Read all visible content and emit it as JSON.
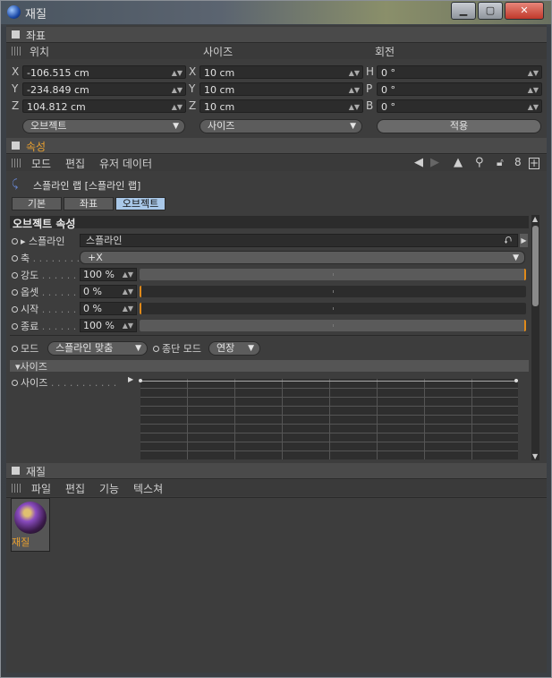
{
  "window": {
    "title": "재질"
  },
  "coords": {
    "panel_title": "좌표",
    "col_position": "위치",
    "col_size": "사이즈",
    "col_rotation": "회전",
    "position": [
      {
        "axis": "X",
        "value": "-106.515 cm"
      },
      {
        "axis": "Y",
        "value": "-234.849 cm"
      },
      {
        "axis": "Z",
        "value": "104.812 cm"
      }
    ],
    "size": [
      {
        "axis": "X",
        "value": "10 cm"
      },
      {
        "axis": "Y",
        "value": "10 cm"
      },
      {
        "axis": "Z",
        "value": "10 cm"
      }
    ],
    "rotation": [
      {
        "axis": "H",
        "value": "0 °"
      },
      {
        "axis": "P",
        "value": "0 °"
      },
      {
        "axis": "B",
        "value": "0 °"
      }
    ],
    "mode_select": "오브젝트",
    "size_select": "사이즈",
    "apply_label": "적용"
  },
  "attributes": {
    "panel_title": "속성",
    "menu": [
      "모드",
      "편집",
      "유저 데이터"
    ],
    "object_title": "스플라인 랩 [스플라인 랩]",
    "tabs": [
      "기본",
      "좌표",
      "오브젝트"
    ],
    "active_tab": 2,
    "section_title": "오브젝트 속성",
    "spline_label": "스플라인",
    "spline_value": "스플라인",
    "axis_label": "축",
    "axis_value": "+X",
    "strength_label": "강도",
    "strength_value": "100 %",
    "strength_fill": 1.0,
    "offset_label": "옵셋",
    "offset_value": "0 %",
    "offset_fill": 0.0,
    "start_label": "시작",
    "start_value": "0 %",
    "start_fill": 0.0,
    "end_label": "종료",
    "end_value": "100 %",
    "end_fill": 1.0,
    "mode_label": "모드",
    "mode_value": "스플라인 맞춤",
    "endmode_label": "종단 모드",
    "endmode_value": "연장",
    "size_group": "사이즈",
    "size_label": "사이즈"
  },
  "materials": {
    "panel_title": "재질",
    "menu": [
      "파일",
      "편집",
      "기능",
      "텍스쳐"
    ],
    "items": [
      {
        "name": "재질"
      }
    ]
  },
  "colors": {
    "accent": "#e8a030",
    "active_tab": "#a9c8e8"
  }
}
